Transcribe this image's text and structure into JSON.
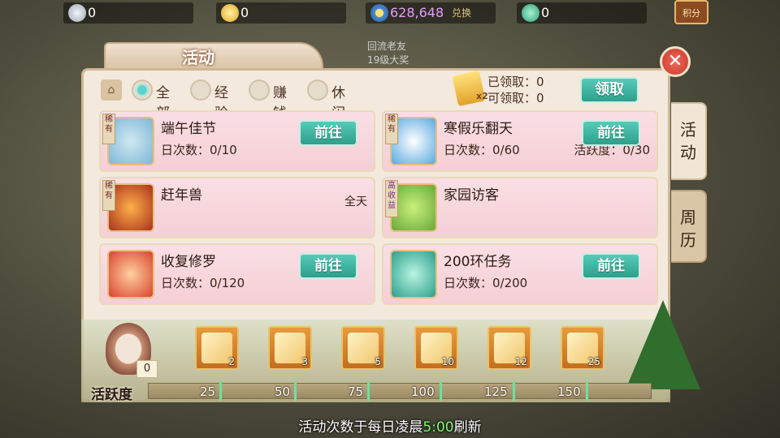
{
  "top_resources": [
    {
      "icon": "silver-ingot-icon",
      "value": "0"
    },
    {
      "icon": "gold-ingot-icon",
      "value": "0"
    },
    {
      "icon": "coin-icon",
      "value": "628,648",
      "suffix": "兑换"
    },
    {
      "icon": "jade-icon",
      "value": "0"
    }
  ],
  "points_button": "积分",
  "background_text": [
    "回流老友",
    "19级大奖"
  ],
  "window": {
    "title": "活动",
    "close_symbol": "✕"
  },
  "filter": {
    "icon": "filter-icon",
    "options": [
      {
        "label": "全部",
        "selected": true
      },
      {
        "label": "经验",
        "selected": false
      },
      {
        "label": "赚钱",
        "selected": false
      },
      {
        "label": "休闲",
        "selected": false
      }
    ]
  },
  "claim": {
    "multiplier": "x2",
    "claimed_label": "已领取：0",
    "claimable_label": "可领取：0",
    "button_label": "领取"
  },
  "activities": [
    {
      "tag": "稀有",
      "name": "端午佳节",
      "count": "日次数：0/10",
      "extra": "",
      "time": "",
      "button": "前往",
      "icon": "dragon-boat-icon"
    },
    {
      "tag": "稀有",
      "name": "寒假乐翻天",
      "count": "日次数：0/60",
      "extra": "活跃度：0/30",
      "time": "",
      "button": "前往",
      "icon": "snowflake-icon"
    },
    {
      "tag": "稀有",
      "name": "赶年兽",
      "count": "",
      "extra": "",
      "time": "全天",
      "button": "",
      "icon": "nian-beast-icon"
    },
    {
      "tag": "高收益",
      "name": "家园访客",
      "count": "",
      "extra": "",
      "time": "",
      "button": "",
      "icon": "home-garden-icon"
    },
    {
      "tag": "",
      "name": "收复修罗",
      "count": "日次数：0/120",
      "extra": "",
      "time": "",
      "button": "前往",
      "icon": "asura-icon"
    },
    {
      "tag": "",
      "name": "200环任务",
      "count": "日次数：0/200",
      "extra": "",
      "time": "",
      "button": "前往",
      "icon": "jade-ring-icon"
    }
  ],
  "side_tabs": [
    {
      "label": "活动",
      "active": true
    },
    {
      "label": "周历",
      "active": false
    }
  ],
  "activity_progress": {
    "label": "活跃度",
    "current": "0",
    "value": 0,
    "thresholds": [
      "25",
      "50",
      "75",
      "100",
      "125",
      "150"
    ],
    "rewards": [
      {
        "count": "2"
      },
      {
        "count": "3"
      },
      {
        "count": "5"
      },
      {
        "count": "10"
      },
      {
        "count": "12"
      },
      {
        "count": "25"
      }
    ]
  },
  "footer": {
    "before": "活动次数于每日凌晨",
    "time": "5:00",
    "after": "刷新"
  },
  "colors": {
    "accent": "#2e9f8c",
    "card": "#f8d8de",
    "highlight": "#7dff6a"
  }
}
